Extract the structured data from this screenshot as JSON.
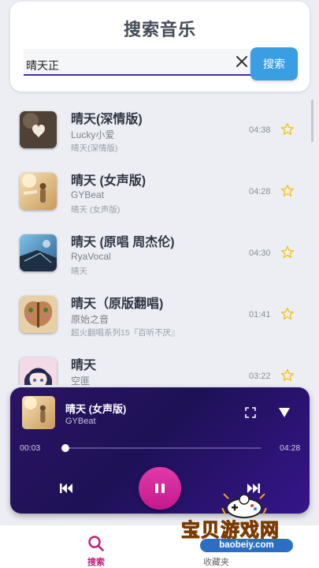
{
  "search": {
    "title": "搜索音乐",
    "value": "晴天正",
    "button_label": "搜索"
  },
  "songs": [
    {
      "title": "晴天(深情版)",
      "artist": "Lucky小爱",
      "album": "晴天(深情版)",
      "duration": "04:38"
    },
    {
      "title": "晴天 (女声版)",
      "artist": "GYBeat",
      "album": "晴天 (女声版)",
      "duration": "04:28"
    },
    {
      "title": "晴天 (原唱 周杰伦)",
      "artist": "RyaVocal",
      "album": "晴天",
      "duration": "04:30"
    },
    {
      "title": "晴天（原版翻唱)",
      "artist": "原始之音",
      "album": "超火翻唱系列15『百听不厌』",
      "duration": "01:41"
    },
    {
      "title": "晴天",
      "artist": "空匪",
      "album": "",
      "duration": "03:22"
    }
  ],
  "player": {
    "title": "晴天 (女声版)",
    "artist": "GYBeat",
    "current_time": "00:03",
    "total_time": "04:28",
    "progress": 0.011
  },
  "nav": {
    "search_label": "搜索",
    "favorites_label": "收藏夹"
  },
  "watermark": {
    "text": "宝贝游戏网",
    "url": "baobeiy.com"
  },
  "colors": {
    "accent": "#3a9ee3",
    "player_bg": "#241260",
    "play_button": "#d42a9e",
    "nav_active": "#c01d7b",
    "star": "#f2c21a"
  }
}
